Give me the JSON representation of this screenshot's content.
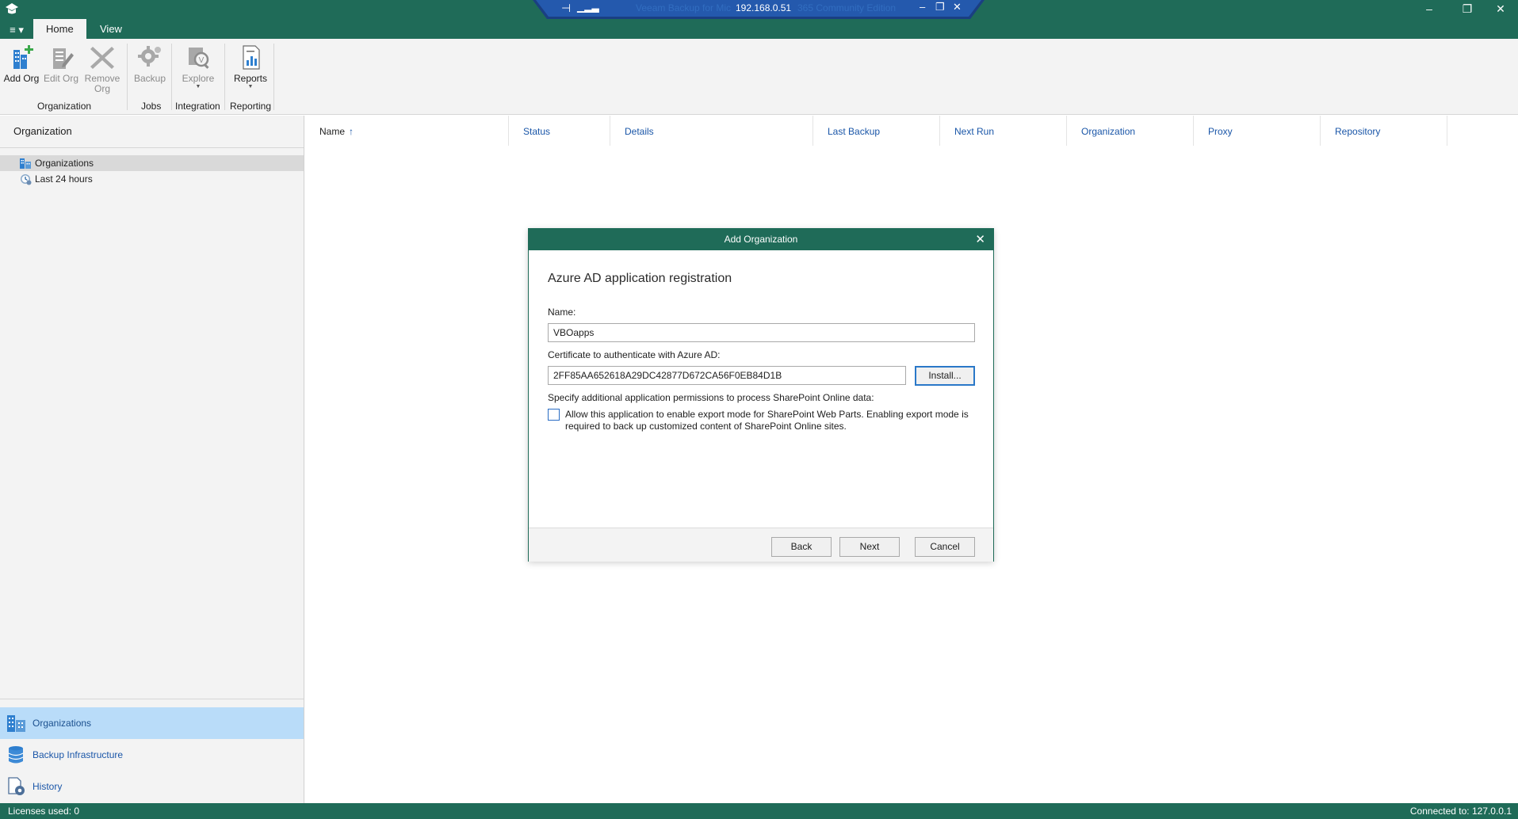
{
  "titlebar": {
    "menu_label": "≡ ▾",
    "remote_ip": "192.168.0.51",
    "remote_faded_left": "Veeam Backup for Mic",
    "remote_faded_right": "365 Community Edition"
  },
  "ribbon": {
    "tabs": [
      {
        "label": "Home",
        "active": true
      },
      {
        "label": "View",
        "active": false
      }
    ],
    "buttons": {
      "add_org": "Add Org",
      "edit_org": "Edit Org",
      "remove_org": "Remove Org",
      "backup": "Backup",
      "explore": "Explore",
      "reports": "Reports"
    },
    "groups": {
      "organization": "Organization",
      "jobs": "Jobs",
      "integration": "Integration",
      "reporting": "Reporting"
    }
  },
  "left_panel": {
    "header": "Organization",
    "tree": [
      {
        "label": "Organizations",
        "selected": true
      },
      {
        "label": "Last 24 hours",
        "selected": false
      }
    ],
    "nav": [
      {
        "label": "Organizations",
        "active": true
      },
      {
        "label": "Backup Infrastructure",
        "active": false
      },
      {
        "label": "History",
        "active": false
      }
    ]
  },
  "grid": {
    "columns": [
      "Name",
      "Status",
      "Details",
      "Last Backup",
      "Next Run",
      "Organization",
      "Proxy",
      "Repository"
    ],
    "sort_indicator": "↑"
  },
  "dialog": {
    "title": "Add Organization",
    "close": "✕",
    "heading": "Azure AD application registration",
    "name_label": "Name:",
    "name_value": "VBOapps",
    "cert_label": "Certificate to authenticate with Azure AD:",
    "cert_value": "2FF85AA652618A29DC42877D672CA56F0EB84D1B",
    "install_button": "Install...",
    "permissions_label": "Specify additional application permissions to process SharePoint Online data:",
    "export_mode_label": "Allow this application to enable export mode for SharePoint Web Parts. Enabling export mode is required to back up customized content of SharePoint Online sites.",
    "export_mode_checked": false,
    "buttons": {
      "back": "Back",
      "next": "Next",
      "cancel": "Cancel"
    }
  },
  "statusbar": {
    "licenses": "Licenses used: 0",
    "connected": "Connected to: 127.0.0.1"
  },
  "colors": {
    "brand": "#1f6b58",
    "link": "#1a56a8",
    "selection": "#b9dcf9"
  }
}
